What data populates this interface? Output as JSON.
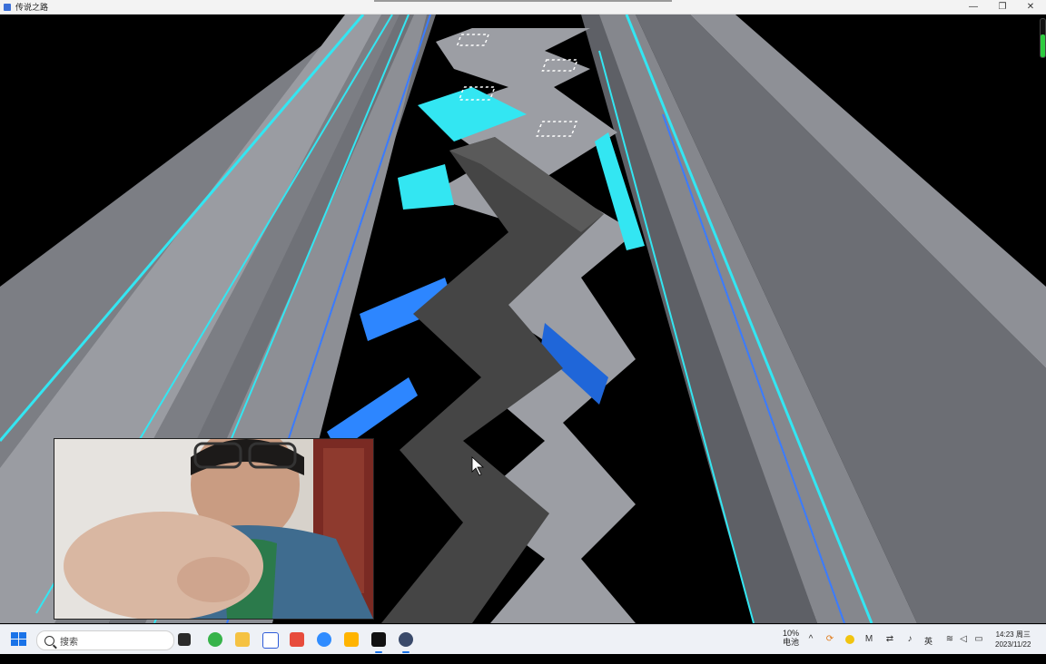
{
  "window": {
    "title": "传说之路",
    "controls": {
      "minimize": "—",
      "maximize": "❐",
      "close": "✕"
    }
  },
  "game": {
    "background_color": "#000000",
    "accent_color": "#33e6f2",
    "path_color": "#454545",
    "pillar_color": "#8e9096",
    "energy_meter_level": 0.6
  },
  "webcam": {
    "visible": true
  },
  "taskbar": {
    "search_placeholder": "搜索",
    "apps": [
      "task-view-icon",
      "edge-browser-icon",
      "file-explorer-icon",
      "wps-icon",
      "red-app-icon",
      "cloud-drive-icon",
      "yellow-app-icon",
      "recorder-icon",
      "game-app-icon"
    ],
    "battery_percent": "10%",
    "battery_label": "电池",
    "ime_label": "英",
    "time": "14:23 周三",
    "date": "2023/11/22"
  }
}
